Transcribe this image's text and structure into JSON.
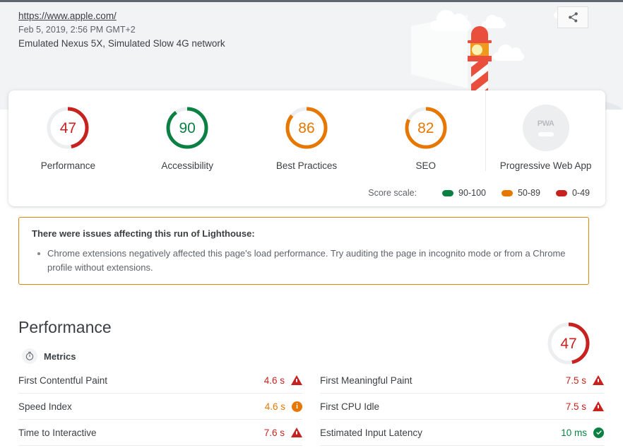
{
  "header": {
    "url": "https://www.apple.com/",
    "timestamp": "Feb 5, 2019, 2:56 PM GMT+2",
    "environment": "Emulated Nexus 5X, Simulated Slow 4G network",
    "share_icon": "share-icon"
  },
  "scores": {
    "categories": [
      {
        "label": "Performance",
        "value": "47",
        "score": 47,
        "color": "#c7221f",
        "type": "gauge"
      },
      {
        "label": "Accessibility",
        "value": "90",
        "score": 90,
        "color": "#0b8043",
        "type": "gauge"
      },
      {
        "label": "Best Practices",
        "value": "86",
        "score": 86,
        "color": "#e67700",
        "type": "gauge"
      },
      {
        "label": "SEO",
        "value": "82",
        "score": 82,
        "color": "#e67700",
        "type": "gauge"
      },
      {
        "label": "Progressive Web App",
        "value": "PWA",
        "score": null,
        "color": "#b9bcbe",
        "type": "badge"
      }
    ],
    "scale_label": "Score scale:",
    "scale": [
      {
        "range": "90-100",
        "color": "#0b8043"
      },
      {
        "range": "50-89",
        "color": "#e67700"
      },
      {
        "range": "0-49",
        "color": "#c7221f"
      }
    ]
  },
  "warning": {
    "title": "There were issues affecting this run of Lighthouse:",
    "items": [
      "Chrome extensions negatively affected this page's load performance. Try auditing the page in incognito mode or from a Chrome profile without extensions."
    ],
    "border_color": "#d9860b"
  },
  "performance": {
    "title": "Performance",
    "score_value": "47",
    "score": 47,
    "score_color": "#c7221f",
    "metrics_heading": "Metrics",
    "metrics_icon": "stopwatch-icon",
    "metrics_left": [
      {
        "name": "First Contentful Paint",
        "value": "4.6 s",
        "status": "fail"
      },
      {
        "name": "Speed Index",
        "value": "4.6 s",
        "status": "average"
      },
      {
        "name": "Time to Interactive",
        "value": "7.6 s",
        "status": "fail"
      }
    ],
    "metrics_right": [
      {
        "name": "First Meaningful Paint",
        "value": "7.5 s",
        "status": "fail"
      },
      {
        "name": "First CPU Idle",
        "value": "7.5 s",
        "status": "fail"
      },
      {
        "name": "Estimated Input Latency",
        "value": "10 ms",
        "status": "pass"
      }
    ]
  }
}
